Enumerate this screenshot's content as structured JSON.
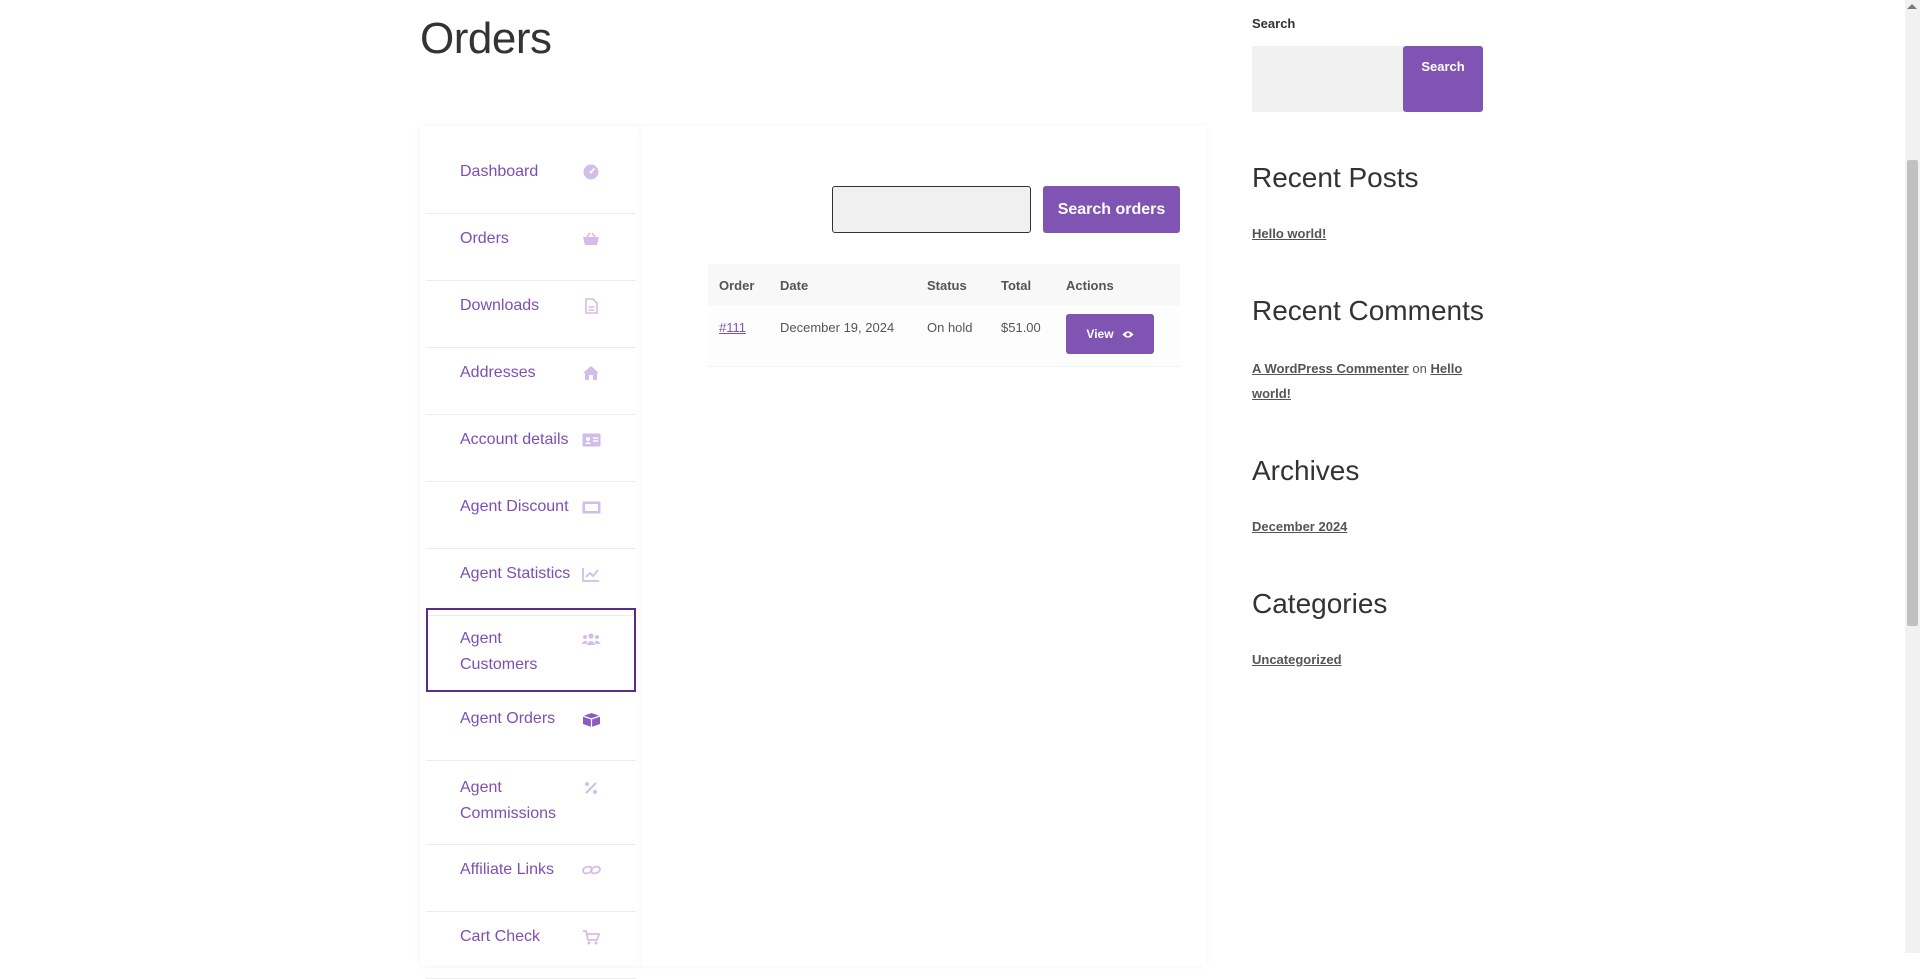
{
  "page": {
    "title": "Orders"
  },
  "account_nav": {
    "items": [
      {
        "label": "Dashboard",
        "icon": "gauge-icon"
      },
      {
        "label": "Orders",
        "icon": "basket-icon"
      },
      {
        "label": "Downloads",
        "icon": "file-icon"
      },
      {
        "label": "Addresses",
        "icon": "home-icon"
      },
      {
        "label": "Account details",
        "icon": "id-card-icon"
      },
      {
        "label": "Agent Discount",
        "icon": "ticket-icon"
      },
      {
        "label": "Agent Statistics",
        "icon": "line-chart-icon"
      },
      {
        "label": "Agent Customers",
        "icon": "users-icon",
        "active": true
      },
      {
        "label": "Agent Orders",
        "icon": "box-icon"
      },
      {
        "label": "Agent Commissions",
        "icon": "percent-icon"
      },
      {
        "label": "Affiliate Links",
        "icon": "link-icon"
      },
      {
        "label": "Cart Check",
        "icon": "cart-icon"
      }
    ]
  },
  "orders": {
    "search_button": "Search orders",
    "columns": [
      "Order",
      "Date",
      "Status",
      "Total",
      "Actions"
    ],
    "rows": [
      {
        "order": "#111",
        "date": "December 19, 2024",
        "status": "On hold",
        "total": "$51.00",
        "action": "View"
      }
    ]
  },
  "sidebar": {
    "search_label": "Search",
    "search_button": "Search",
    "recent_posts_title": "Recent Posts",
    "recent_posts": [
      "Hello world!"
    ],
    "recent_comments_title": "Recent Comments",
    "recent_comment": {
      "author": "A WordPress Commenter",
      "on": "on",
      "post": "Hello world!"
    },
    "archives_title": "Archives",
    "archives": [
      "December 2024"
    ],
    "categories_title": "Categories",
    "categories": [
      "Uncategorized"
    ]
  },
  "colors": {
    "accent": "#7f54b3",
    "nav_text": "#7e4fb3",
    "nav_icon": "#d2bde8",
    "active_border": "#5a2a8e"
  }
}
